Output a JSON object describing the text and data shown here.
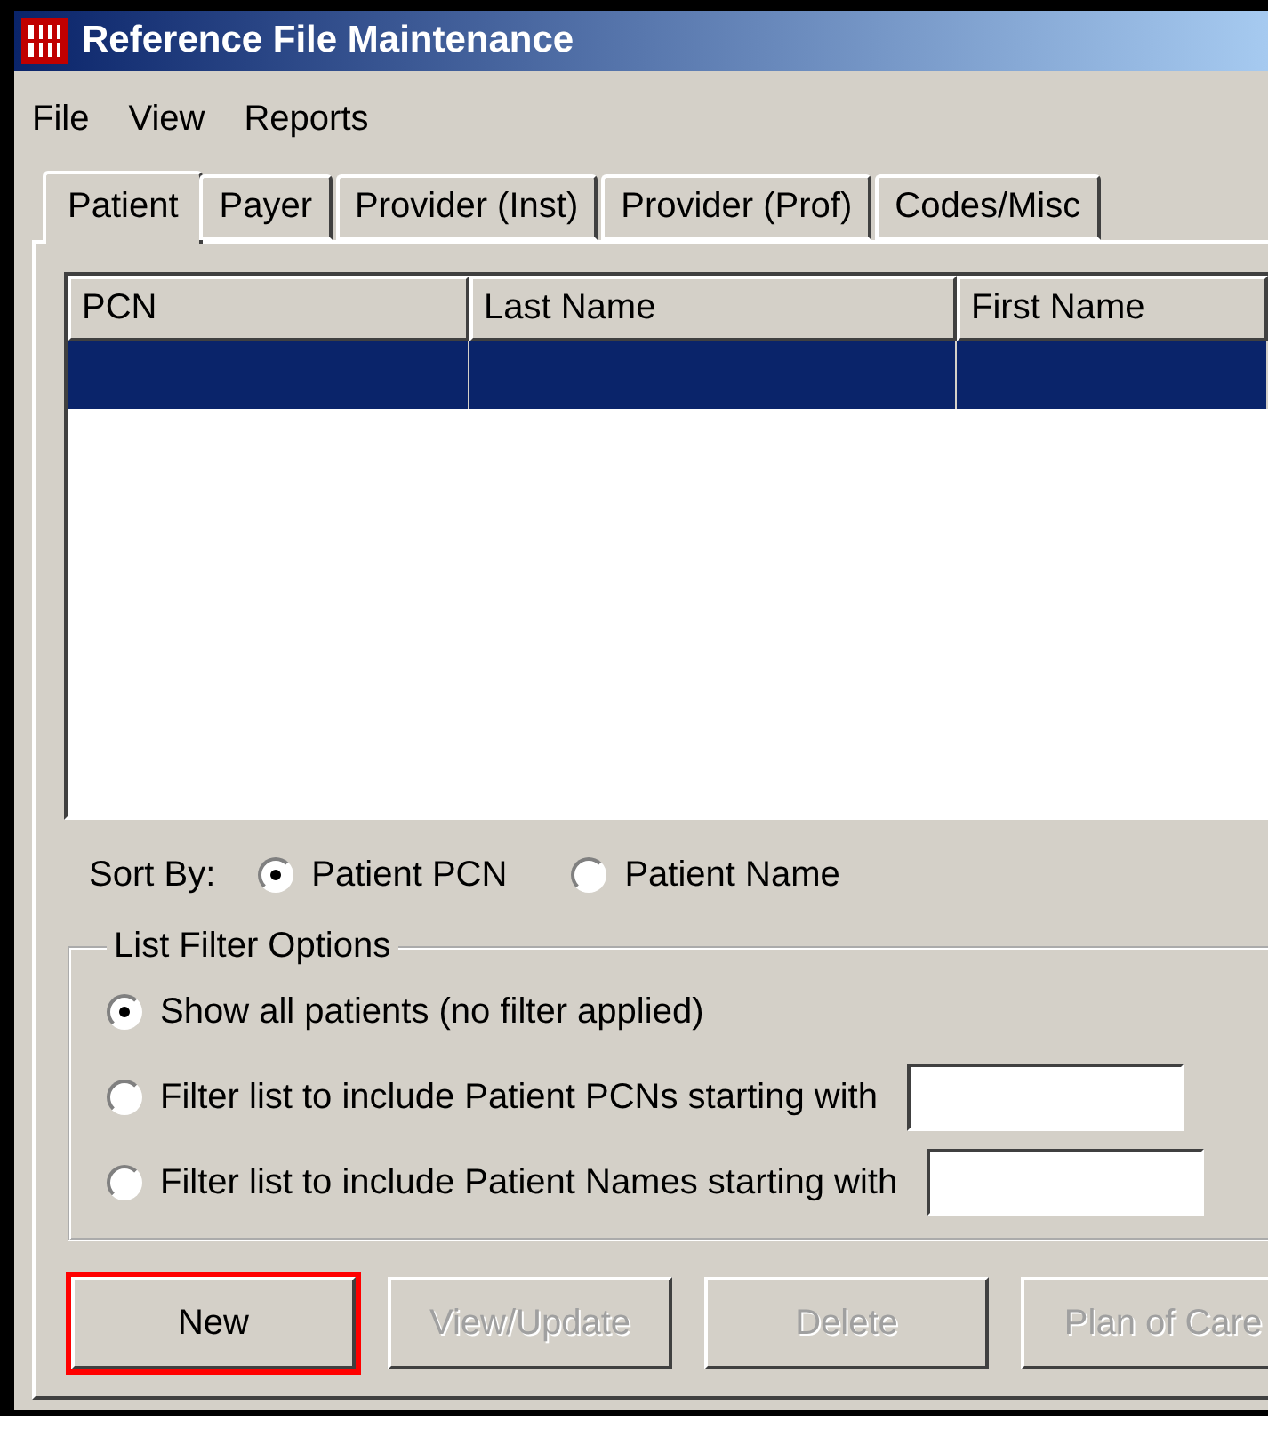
{
  "window": {
    "title": "Reference File Maintenance"
  },
  "menu": [
    "File",
    "View",
    "Reports"
  ],
  "tabs": [
    {
      "label": "Patient",
      "selected": true
    },
    {
      "label": "Payer",
      "selected": false
    },
    {
      "label": "Provider (Inst)",
      "selected": false
    },
    {
      "label": "Provider (Prof)",
      "selected": false
    },
    {
      "label": "Codes/Misc",
      "selected": false
    }
  ],
  "table": {
    "columns": [
      "PCN",
      "Last Name",
      "First Name"
    ],
    "rows": [
      {
        "cells": [
          "",
          "",
          ""
        ],
        "selected": true
      }
    ]
  },
  "sort": {
    "label": "Sort By:",
    "options": [
      {
        "label": "Patient PCN",
        "selected": true
      },
      {
        "label": "Patient Name",
        "selected": false
      }
    ]
  },
  "filter": {
    "title": "List Filter Options",
    "options": [
      {
        "label": "Show all patients (no filter applied)",
        "selected": true,
        "kind": "plain"
      },
      {
        "label": "Filter list to include Patient PCNs starting with",
        "selected": false,
        "kind": "field"
      },
      {
        "label": "Filter list to include Patient Names starting with",
        "selected": false,
        "kind": "field"
      }
    ]
  },
  "buttons": [
    {
      "label": "New",
      "disabled": false,
      "highlighted": true
    },
    {
      "label": "View/Update",
      "disabled": true,
      "highlighted": false
    },
    {
      "label": "Delete",
      "disabled": true,
      "highlighted": false
    },
    {
      "label": "Plan of Care",
      "disabled": true,
      "highlighted": false
    }
  ]
}
